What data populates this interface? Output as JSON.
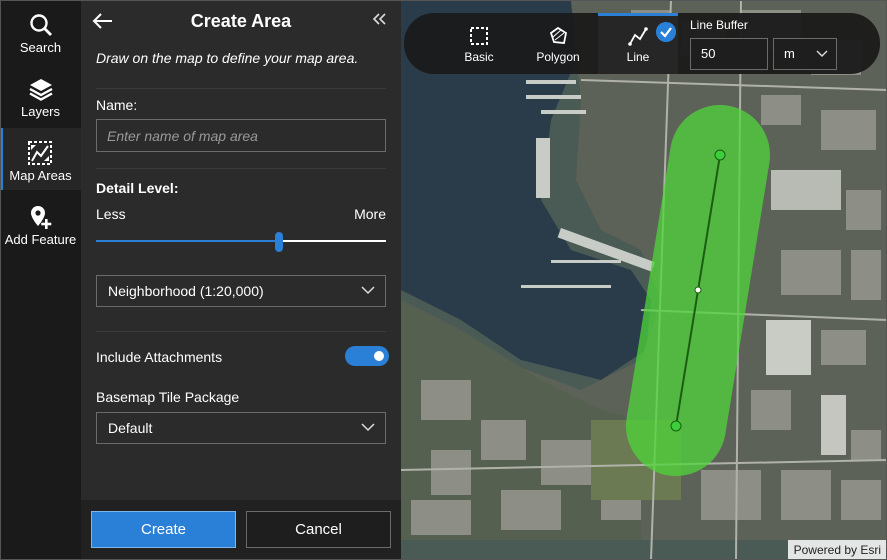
{
  "nav": {
    "items": [
      {
        "label": "Search",
        "icon": "search-icon"
      },
      {
        "label": "Layers",
        "icon": "layers-icon"
      },
      {
        "label": "Map Areas",
        "icon": "map-areas-icon"
      },
      {
        "label": "Add Feature",
        "icon": "add-feature-icon"
      }
    ],
    "active": "Map Areas"
  },
  "panel": {
    "title": "Create Area",
    "instructions": "Draw on the map to define your map area.",
    "name_label": "Name:",
    "name_placeholder": "Enter name of map area",
    "name_value": "",
    "detail_label": "Detail Level:",
    "less_label": "Less",
    "more_label": "More",
    "detail_level_fraction": 0.63,
    "detail_select": "Neighborhood (1:20,000)",
    "attachments_label": "Include Attachments",
    "attachments_on": true,
    "basemap_label": "Basemap Tile Package",
    "basemap_select": "Default",
    "create_label": "Create",
    "cancel_label": "Cancel"
  },
  "toolbar": {
    "tools": [
      {
        "label": "Basic",
        "icon": "rectangle-select-icon"
      },
      {
        "label": "Polygon",
        "icon": "polygon-icon"
      },
      {
        "label": "Line",
        "icon": "line-icon"
      }
    ],
    "active_tool": "Line",
    "buffer_label": "Line Buffer",
    "buffer_value": "50",
    "buffer_unit": "m"
  },
  "map": {
    "attribution": "Powered by Esri",
    "buffer_color": "#4fd63a"
  },
  "colors": {
    "accent": "#2a7fd6",
    "panel_bg": "#2b2b2b",
    "rail_bg": "#1a1a1a"
  }
}
